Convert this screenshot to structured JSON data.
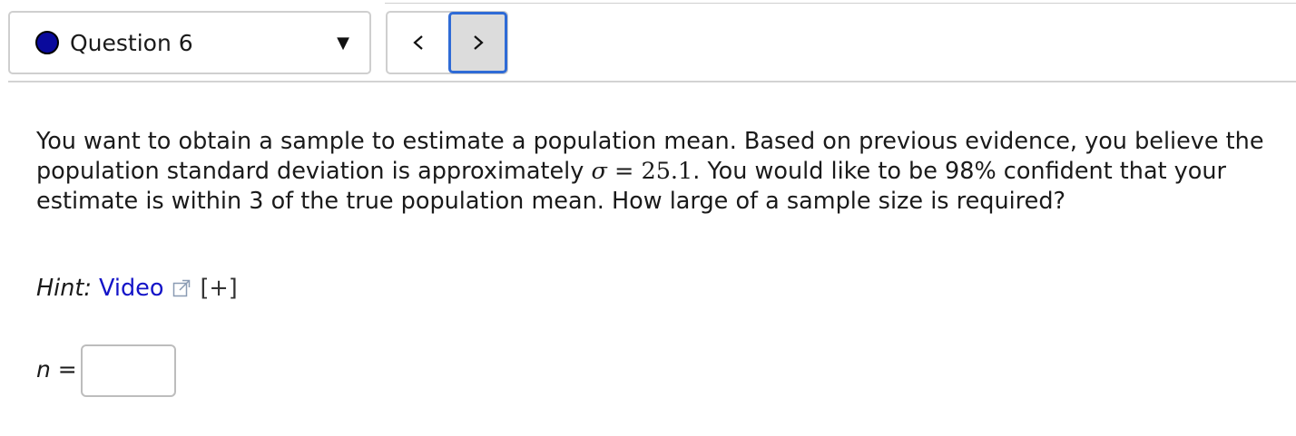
{
  "question_nav": {
    "selected_question": "Question 6",
    "status_color": "#0a0a9c",
    "caret_icon": "caret-down-icon",
    "prev_icon": "chevron-left-icon",
    "next_icon": "chevron-right-icon",
    "prev_label": "<",
    "next_label": ">"
  },
  "question": {
    "text_part1": "You want to obtain a sample to estimate a population mean. Based on previous evidence, you believe the population standard deviation is approximately ",
    "sigma_symbol": "σ",
    "equals": " = ",
    "sigma_value": "25.1",
    "text_part2": ". You would like to be 98% confident that your estimate is within 3 of the true population mean. How large of a sample size is required?"
  },
  "hint": {
    "label": "Hint:",
    "video_link": "Video",
    "external_icon": "external-link-icon",
    "expand": "[+]"
  },
  "answer": {
    "variable": "n",
    "equals": " =",
    "value": ""
  }
}
